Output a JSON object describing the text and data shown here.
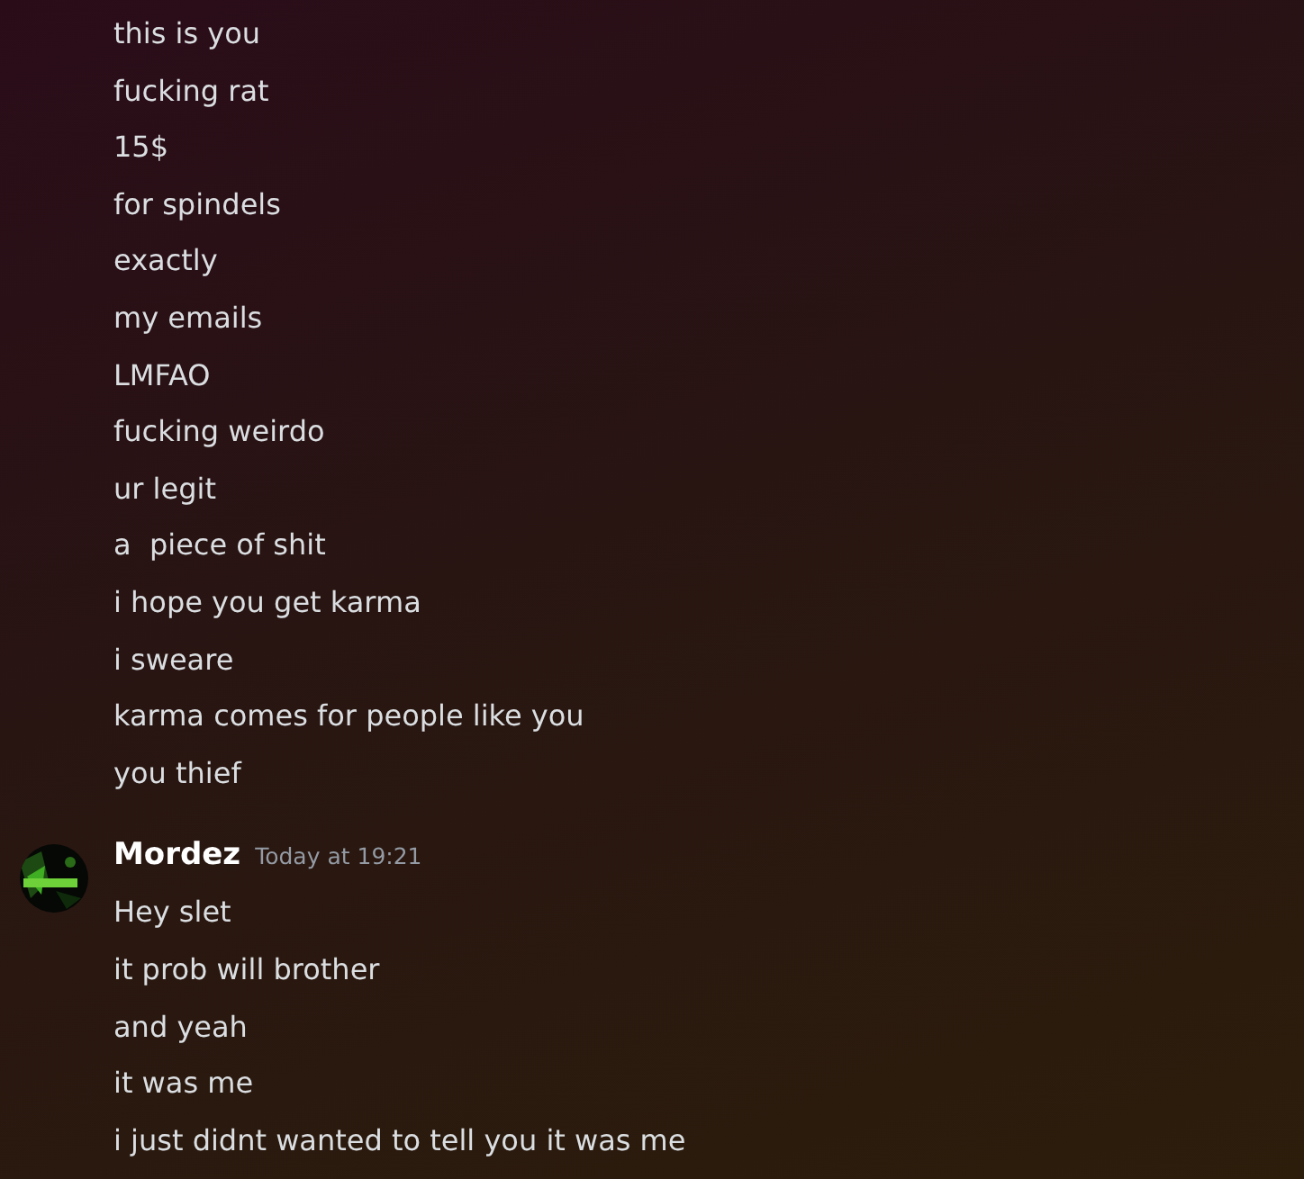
{
  "message_groups": [
    {
      "messages": [
        "this is you",
        "fucking rat",
        "15$",
        "for spindels",
        "exactly",
        "my emails",
        "LMFAO",
        "fucking weirdo",
        "ur legit",
        "a  piece of shit",
        "i hope you get karma",
        "i sweare",
        "karma comes for people like you",
        "you thief"
      ]
    },
    {
      "author": "Mordez",
      "timestamp": "Today at 19:21",
      "messages": [
        "Hey slet",
        "it prob will brother",
        "and yeah",
        "it was me",
        "i just didnt wanted to tell you it was me"
      ]
    }
  ]
}
